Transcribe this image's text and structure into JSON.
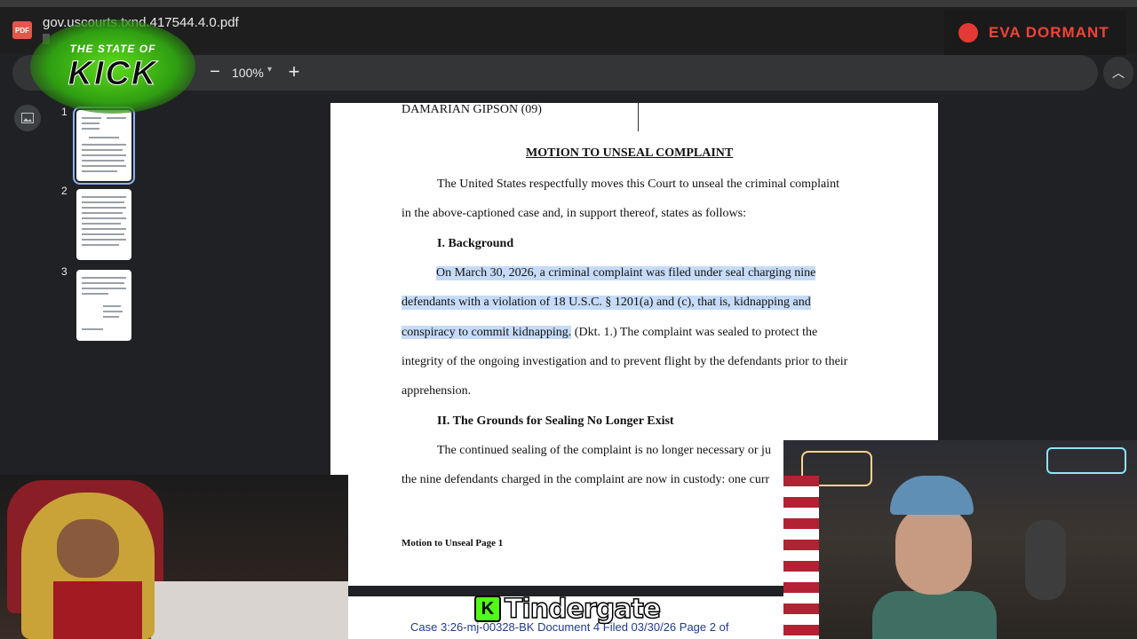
{
  "window": {
    "file_icon": "PDF",
    "file_title": "gov.uscourts.txnd.417544.4.0.pdf"
  },
  "toolbar": {
    "zoom_out_label": "−",
    "zoom_value": "100%",
    "zoom_caret": "▾",
    "zoom_in_label": "+",
    "collapse_label": "︿"
  },
  "sidebar": {
    "thumbnails": [
      {
        "number": "1"
      },
      {
        "number": "2"
      },
      {
        "number": "3"
      }
    ]
  },
  "document": {
    "defendant_line": "DAMARIAN GIPSON (09)",
    "heading": "MOTION TO UNSEAL COMPLAINT",
    "intro_1": "The United States respectfully moves this Court to unseal the criminal complaint",
    "intro_2": "in the above-captioned case and, in support thereof, states as follows:",
    "section_1": "I. Background",
    "bg_1": "On March 30, 2026, a criminal complaint was filed under seal charging nine",
    "bg_2": "defendants with a violation of 18 U.S.C. § 1201(a) and (c), that is, kidnapping and",
    "bg_3a": "conspiracy to commit kidnapping.",
    "bg_3b": " (Dkt. 1.) The complaint was sealed to protect the",
    "bg_4": "integrity of the ongoing investigation and to prevent flight by the defendants prior to their",
    "bg_5": "apprehension.",
    "section_2": "II. The Grounds for Sealing No Longer Exist",
    "gr_1": "The continued sealing of the complaint is no longer necessary or ju",
    "gr_2": "the nine defendants charged in the complaint are now in custody: one curr",
    "footer": "Motion to Unseal Page 1",
    "page2_header": "Case 3:26-mj-00328-BK     Document 4     Filed 03/30/26     Page 2 of"
  },
  "overlays": {
    "live_label": "EVA DORMANT",
    "logo_small": "THE STATE OF",
    "logo_big": "KICK",
    "sticker_k": "K",
    "sticker_text": "Tindergate"
  },
  "colors": {
    "highlight": "#c6dbf7",
    "accent_blue": "#8ab4f8",
    "kick_green": "#53fc18",
    "live_red": "#e53935"
  }
}
